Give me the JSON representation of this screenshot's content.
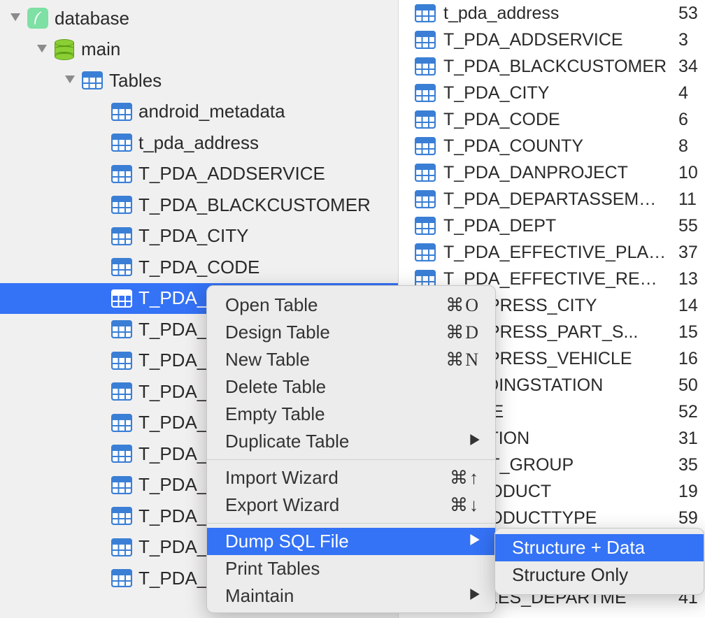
{
  "tree": {
    "root": {
      "label": "database"
    },
    "schema": {
      "label": "main"
    },
    "tables_group": {
      "label": "Tables"
    },
    "tables": [
      {
        "label": "android_metadata"
      },
      {
        "label": "t_pda_address"
      },
      {
        "label": "T_PDA_ADDSERVICE"
      },
      {
        "label": "T_PDA_BLACKCUSTOMER"
      },
      {
        "label": "T_PDA_CITY"
      },
      {
        "label": "T_PDA_CODE"
      },
      {
        "label": "T_PDA_COUNTY"
      },
      {
        "label": "T_PDA_"
      },
      {
        "label": "T_PDA_"
      },
      {
        "label": "T_PDA_"
      },
      {
        "label": "T_PDA_"
      },
      {
        "label": "T_PDA_"
      },
      {
        "label": "T_PDA_"
      },
      {
        "label": "T_PDA_"
      },
      {
        "label": "T_PDA_"
      },
      {
        "label": "T_PDA_"
      }
    ]
  },
  "right_list": [
    {
      "name": "t_pda_address",
      "count": "53"
    },
    {
      "name": "T_PDA_ADDSERVICE",
      "count": "3"
    },
    {
      "name": "T_PDA_BLACKCUSTOMER",
      "count": "34"
    },
    {
      "name": "T_PDA_CITY",
      "count": "4"
    },
    {
      "name": "T_PDA_CODE",
      "count": "6"
    },
    {
      "name": "T_PDA_COUNTY",
      "count": "8"
    },
    {
      "name": "T_PDA_DANPROJECT",
      "count": "10"
    },
    {
      "name": "T_PDA_DEPARTASSEMBLY...",
      "count": "11"
    },
    {
      "name": "T_PDA_DEPT",
      "count": "55"
    },
    {
      "name": "T_PDA_EFFECTIVE_PLAN_...",
      "count": "37"
    },
    {
      "name": "T_PDA_EFFECTIVE_REGIO...",
      "count": "13"
    },
    {
      "name": "A_EXPRESS_CITY",
      "count": "14"
    },
    {
      "name": "A_EXPRESS_PART_S...",
      "count": "15"
    },
    {
      "name": "A_EXPRESS_VEHICLE",
      "count": "16"
    },
    {
      "name": "A_LADINGSTATION",
      "count": "50"
    },
    {
      "name": "A_LINE",
      "count": "52"
    },
    {
      "name": "A_NATION",
      "count": "31"
    },
    {
      "name": "A_NET_GROUP",
      "count": "35"
    },
    {
      "name": "A_PRODUCT",
      "count": "19"
    },
    {
      "name": "A_PRODUCTTYPE",
      "count": "59"
    },
    {
      "name": "",
      "count": ""
    },
    {
      "name": "",
      "count": ""
    },
    {
      "name": "A_SALES_DEPARTME",
      "count": "41"
    }
  ],
  "context_menu": {
    "items": [
      {
        "label": "Open Table",
        "shortcut": "⌘O"
      },
      {
        "label": "Design Table",
        "shortcut": "⌘D"
      },
      {
        "label": "New Table",
        "shortcut": "⌘N"
      },
      {
        "label": "Delete Table",
        "shortcut": ""
      },
      {
        "label": "Empty Table",
        "shortcut": ""
      },
      {
        "label": "Duplicate Table",
        "shortcut": "",
        "submenu": true
      }
    ],
    "group2": [
      {
        "label": "Import Wizard",
        "shortcut": "⌘↑"
      },
      {
        "label": "Export Wizard",
        "shortcut": "⌘↓"
      }
    ],
    "group3": [
      {
        "label": "Dump SQL File",
        "shortcut": "",
        "submenu": true,
        "hl": true
      },
      {
        "label": "Print Tables",
        "shortcut": ""
      },
      {
        "label": "Maintain",
        "shortcut": "",
        "submenu": true
      }
    ]
  },
  "submenu": {
    "items": [
      {
        "label": "Structure + Data",
        "hl": true
      },
      {
        "label": "Structure Only"
      }
    ]
  }
}
